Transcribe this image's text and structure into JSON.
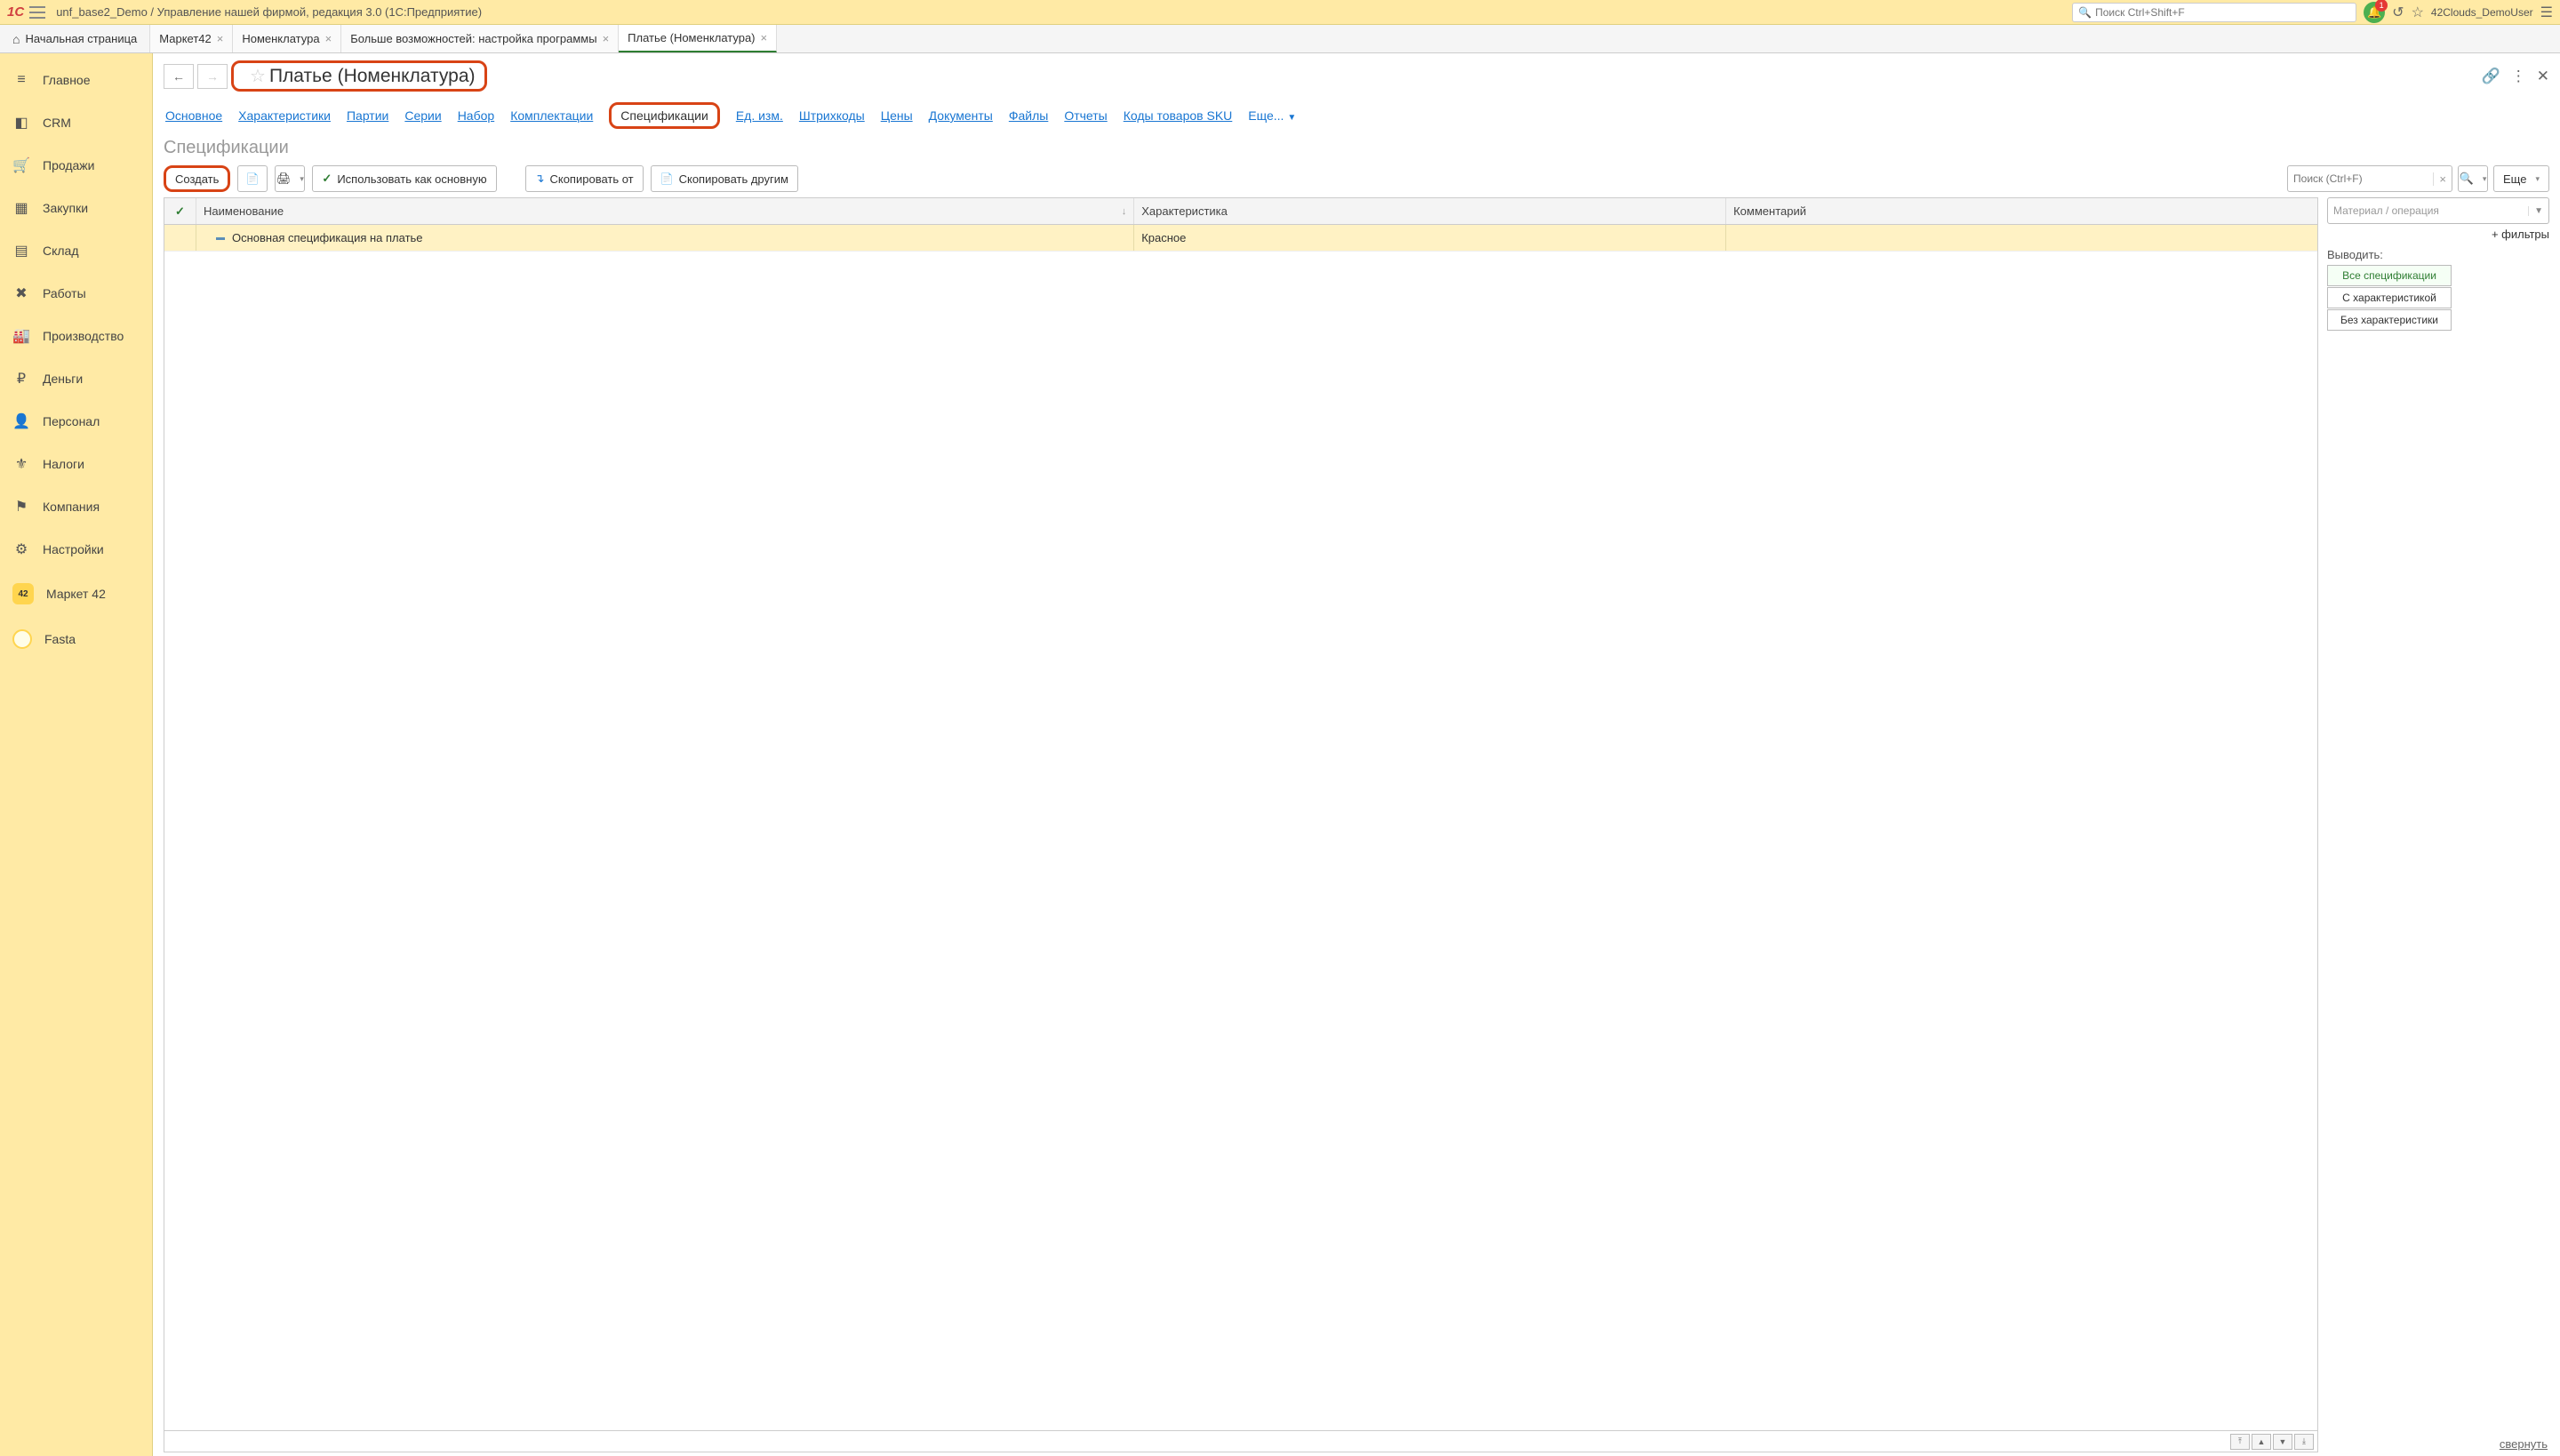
{
  "titlebar": {
    "app_title": "unf_base2_Demo / Управление нашей фирмой, редакция 3.0  (1С:Предприятие)",
    "search_placeholder": "Поиск Ctrl+Shift+F",
    "bell_badge": "1",
    "username": "42Clouds_DemoUser"
  },
  "tabs": {
    "home": "Начальная страница",
    "items": [
      {
        "label": "Маркет42",
        "active": false
      },
      {
        "label": "Номенклатура",
        "active": false
      },
      {
        "label": "Больше возможностей: настройка программы",
        "active": false
      },
      {
        "label": "Платье (Номенклатура)",
        "active": true
      }
    ]
  },
  "sidebar": {
    "items": [
      {
        "label": "Главное",
        "icon": "≡"
      },
      {
        "label": "CRM",
        "icon": "◧"
      },
      {
        "label": "Продажи",
        "icon": "🛒"
      },
      {
        "label": "Закупки",
        "icon": "▦"
      },
      {
        "label": "Склад",
        "icon": "▤"
      },
      {
        "label": "Работы",
        "icon": "✖"
      },
      {
        "label": "Производство",
        "icon": "🏭"
      },
      {
        "label": "Деньги",
        "icon": "₽"
      },
      {
        "label": "Персонал",
        "icon": "👤"
      },
      {
        "label": "Налоги",
        "icon": "⚜"
      },
      {
        "label": "Компания",
        "icon": "⚑"
      },
      {
        "label": "Настройки",
        "icon": "⚙"
      }
    ],
    "extra": [
      {
        "label": "Маркет 42",
        "kind": "42"
      },
      {
        "label": "Fasta",
        "kind": "fasta"
      }
    ]
  },
  "page": {
    "title": "Платье (Номенклатура)",
    "section_tabs": [
      "Основное",
      "Характеристики",
      "Партии",
      "Серии",
      "Набор",
      "Комплектации",
      "Спецификации",
      "Ед. изм.",
      "Штрихкоды",
      "Цены",
      "Документы",
      "Файлы",
      "Отчеты",
      "Коды товаров SKU"
    ],
    "more_label": "Еще...",
    "active_section_index": 6,
    "section_title": "Спецификации"
  },
  "toolbar": {
    "create": "Создать",
    "use_main": "Использовать как основную",
    "copy_from": "Скопировать от",
    "copy_to": "Скопировать другим",
    "search_placeholder": "Поиск (Ctrl+F)",
    "more": "Еще"
  },
  "table": {
    "columns": {
      "name": "Наименование",
      "char": "Характеристика",
      "comment": "Комментарий"
    },
    "rows": [
      {
        "name": "Основная спецификация на платье",
        "char": "Красное",
        "comment": ""
      }
    ]
  },
  "right_panel": {
    "filter_placeholder": "Материал / операция",
    "filters_link": "+ фильтры",
    "output_label": "Выводить:",
    "buttons": [
      "Все спецификации",
      "С характеристикой",
      "Без характеристики"
    ],
    "active_button_index": 0
  },
  "footer": {
    "collapse": "свернуть"
  }
}
